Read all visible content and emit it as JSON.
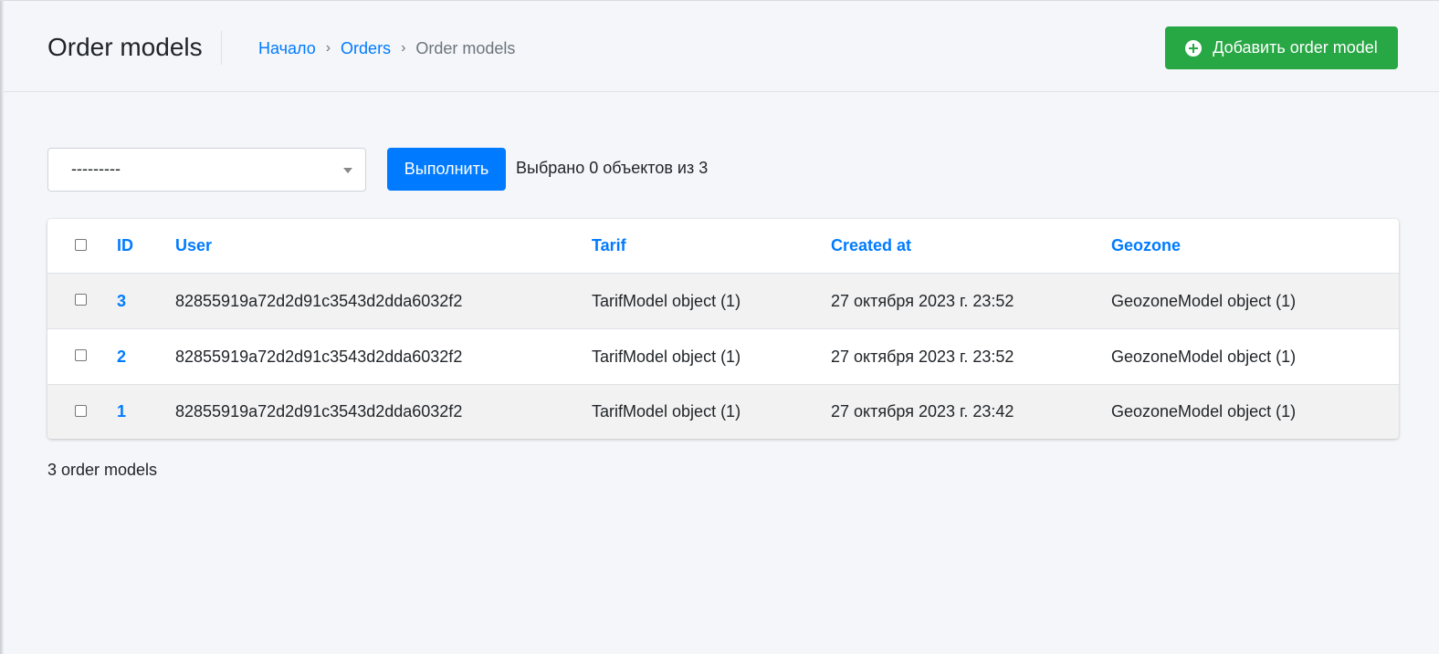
{
  "header": {
    "title": "Order models",
    "breadcrumb": {
      "home": "Начало",
      "separator": "›",
      "section": "Orders",
      "current": "Order models"
    },
    "add_button_label": "Добавить order model",
    "add_button_icon": "plus-circle-icon"
  },
  "actions": {
    "select_value": "---------",
    "run_label": "Выполнить",
    "selected_text": "Выбрано 0 объектов из 3"
  },
  "table": {
    "columns": {
      "id": "ID",
      "user": "User",
      "tarif": "Tarif",
      "created": "Created at",
      "geozone": "Geozone"
    },
    "rows": [
      {
        "id": "3",
        "user": "82855919a72d2d91c3543d2dda6032f2",
        "tarif": "TarifModel object (1)",
        "created": "27 октября 2023 г. 23:52",
        "geozone": "GeozoneModel object (1)"
      },
      {
        "id": "2",
        "user": "82855919a72d2d91c3543d2dda6032f2",
        "tarif": "TarifModel object (1)",
        "created": "27 октября 2023 г. 23:52",
        "geozone": "GeozoneModel object (1)"
      },
      {
        "id": "1",
        "user": "82855919a72d2d91c3543d2dda6032f2",
        "tarif": "TarifModel object (1)",
        "created": "27 октября 2023 г. 23:42",
        "geozone": "GeozoneModel object (1)"
      }
    ]
  },
  "footer": {
    "count_text": "3 order models"
  },
  "colors": {
    "primary": "#007bff",
    "success": "#28a745",
    "background": "#f4f6f9"
  }
}
